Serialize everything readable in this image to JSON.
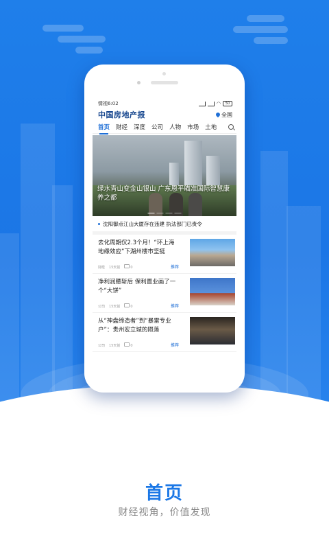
{
  "status_bar": {
    "carrier_time": "情视6:02",
    "battery": "50"
  },
  "app": {
    "logo_text": "中国房地产报",
    "region_label": "全国"
  },
  "tabs": [
    {
      "label": "首页",
      "active": true
    },
    {
      "label": "财经"
    },
    {
      "label": "深度"
    },
    {
      "label": "公司"
    },
    {
      "label": "人物"
    },
    {
      "label": "市场"
    },
    {
      "label": "土地"
    }
  ],
  "banner": {
    "title": "绿水青山变金山银山 广东恩平瞄准国际智慧康养之都"
  },
  "ticker": {
    "text": "沈阳御点江山大厦存在违建 执法部门已责令"
  },
  "news": [
    {
      "title": "去化周期仅2.3个月！“环上海地缘效应”下湖州楼市坚挺",
      "source": "财经",
      "time": "15天前",
      "comments": "0",
      "tag": "推荐"
    },
    {
      "title": "净利润腰斩后 保利置业画了一个“大饼”",
      "source": "公司",
      "time": "15天前",
      "comments": "0",
      "tag": "推荐"
    },
    {
      "title": "从“神盘缔造者”到“暴雷专业户”：贵州宏立城的陨落",
      "source": "公司",
      "time": "15天前",
      "comments": "0",
      "tag": "推荐"
    }
  ],
  "caption": {
    "title": "首页",
    "subtitle": "财经视角，价值发现"
  },
  "colors": {
    "brand_blue": "#1a77e6",
    "logo_navy": "#16468e"
  }
}
